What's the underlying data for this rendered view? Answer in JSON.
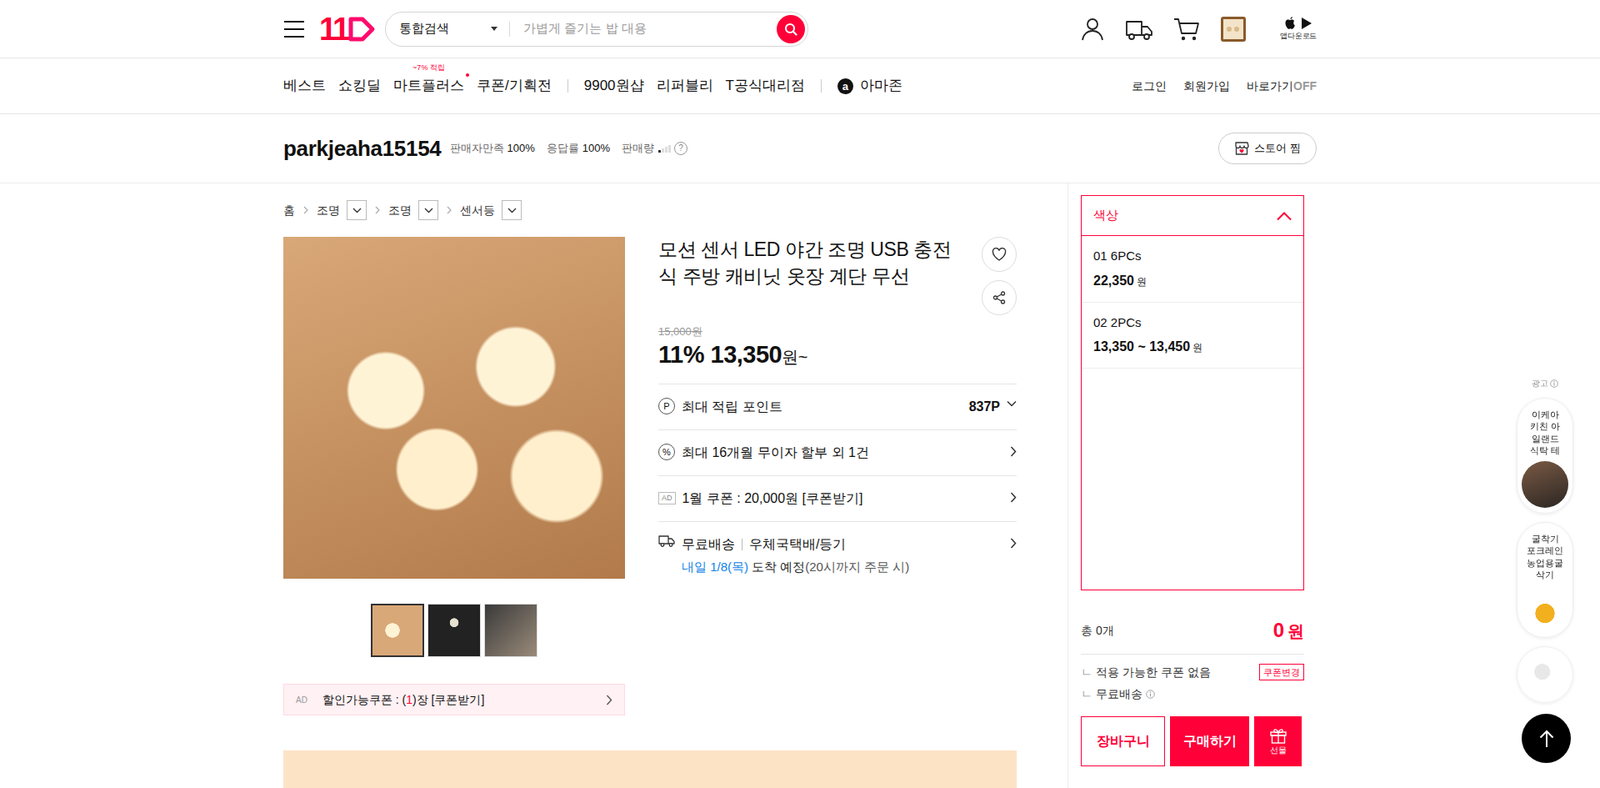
{
  "header": {
    "logo": "11",
    "search": {
      "scope": "통합검색",
      "placeholder": "가볍게 즐기는 밥 대용"
    },
    "app_download": "앱다운로드"
  },
  "nav": {
    "groups": [
      [
        {
          "label": "베스트",
          "dot": false
        },
        {
          "label": "쇼킹딜",
          "dot": false
        },
        {
          "label": "마트플러스",
          "badge": "~7% 적립",
          "dot": true
        },
        {
          "label": "쿠폰/기획전",
          "dot": false
        }
      ],
      [
        {
          "label": "9900원샵",
          "dot": false
        },
        {
          "label": "리퍼블리",
          "dot": false
        },
        {
          "label": "T공식대리점",
          "dot": false
        }
      ],
      [
        {
          "label": "아마존",
          "mark": "a",
          "dot": false
        }
      ]
    ],
    "links": [
      "로그인",
      "회원가입"
    ],
    "shortcut": {
      "label": "바로가기",
      "state": "OFF"
    }
  },
  "seller": {
    "name": "parkjeaha15154",
    "stats": [
      {
        "label": "판매자만족",
        "value": "100%"
      },
      {
        "label": "응답률",
        "value": "100%"
      }
    ],
    "sales": {
      "label": "판매량",
      "level": 0.25,
      "help": "?"
    },
    "store_button": "스토어 찜"
  },
  "breadcrumb": [
    {
      "label": "홈",
      "dropdown": false
    },
    {
      "label": "조명",
      "dropdown": true
    },
    {
      "label": "조명",
      "dropdown": true
    },
    {
      "label": "센서등",
      "dropdown": true
    }
  ],
  "product": {
    "thumbnails": [
      {
        "selected": true
      },
      {
        "selected": false
      },
      {
        "selected": false
      }
    ],
    "coupon_bar": {
      "ad": "AD",
      "before": "할인가능쿠폰 : (",
      "count": "1",
      "after": ")장 [쿠폰받기]"
    },
    "title": "모션 센서 LED 야간 조명 USB 충전식 주방 캐비닛 옷장 계단 무선",
    "wish": false,
    "original_price": "15,000원",
    "discount": "11%",
    "price": "13,350",
    "price_unit": "원~",
    "benefits": [
      {
        "kind": "point",
        "icon": "P",
        "label": "최대 적립 포인트",
        "value": "837P",
        "expanded": false
      },
      {
        "kind": "link",
        "icon": "%",
        "label": "최대 16개월 무이자 할부 외 1건"
      },
      {
        "kind": "ad",
        "icon": "AD",
        "label": "1월 쿠폰 : 20,000원 [쿠폰받기]"
      },
      {
        "kind": "delivery",
        "label": "무료배송",
        "sub": "우체국택배/등기",
        "eta": "내일 1/8(목)",
        "eta_text": "도착 예정",
        "eta_note": "(20시까지 주문 시)"
      }
    ]
  },
  "options": {
    "title": "색상",
    "expanded": true,
    "items": [
      {
        "name": "01 6PCs",
        "price": "22,350",
        "unit": "원"
      },
      {
        "name": "02 2PCs",
        "price": "13,350 ~ 13,450",
        "unit": "원"
      }
    ]
  },
  "summary": {
    "total_label": "총 0개",
    "total_price": "0",
    "price_unit": "원",
    "coupon_mark": "ㄴ",
    "coupon": "적용 가능한 쿠폰 없음",
    "coupon_button": "쿠폰변경",
    "shipping_mark": "ㄴ",
    "shipping": "무료배송"
  },
  "buttons": {
    "cart": "장바구니",
    "buy": "구매하기",
    "gift": "선물"
  },
  "side_ads": {
    "label": "광고",
    "items": [
      {
        "kind": "caption",
        "text": "이케아 키친 아일랜드 식탁 테"
      },
      {
        "kind": "caption",
        "text": "굴착기 포크레인 농업용굴삭기"
      },
      {
        "kind": "image"
      }
    ]
  }
}
